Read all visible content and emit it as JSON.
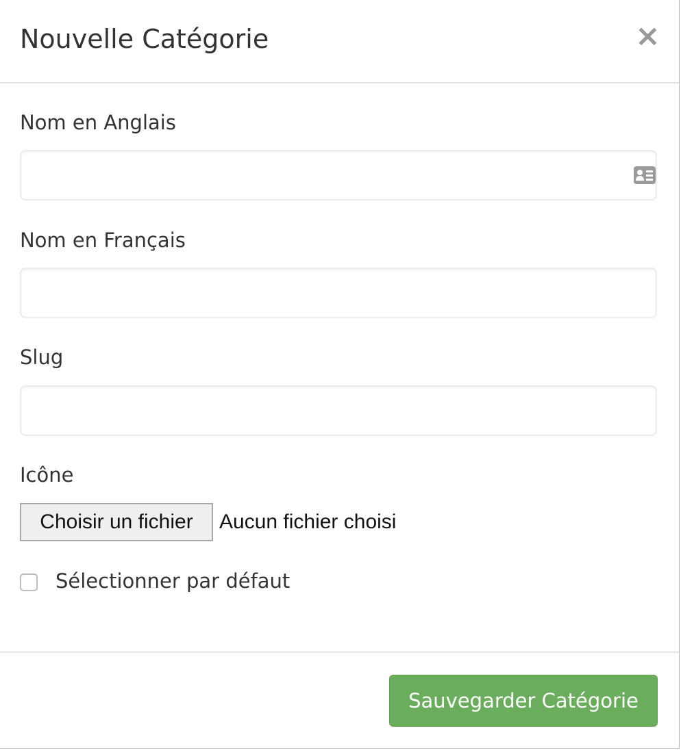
{
  "modal": {
    "title": "Nouvelle Catégorie",
    "close_symbol": "×",
    "close_icon": "close-icon"
  },
  "form": {
    "name_en": {
      "label": "Nom en Anglais",
      "value": "",
      "icon": "contact-card-icon"
    },
    "name_fr": {
      "label": "Nom en Français",
      "value": ""
    },
    "slug": {
      "label": "Slug",
      "value": ""
    },
    "icon_field": {
      "label": "Icône",
      "button_label": "Choisir un fichier",
      "status": "Aucun fichier choisi"
    },
    "default_checkbox": {
      "label": "Sélectionner par défaut",
      "checked": false
    }
  },
  "footer": {
    "save_label": "Sauvegarder Catégorie"
  },
  "colors": {
    "primary_button": "#6aad5c",
    "text": "#333333",
    "close_icon": "#999999",
    "divider": "#e5e5e5"
  }
}
